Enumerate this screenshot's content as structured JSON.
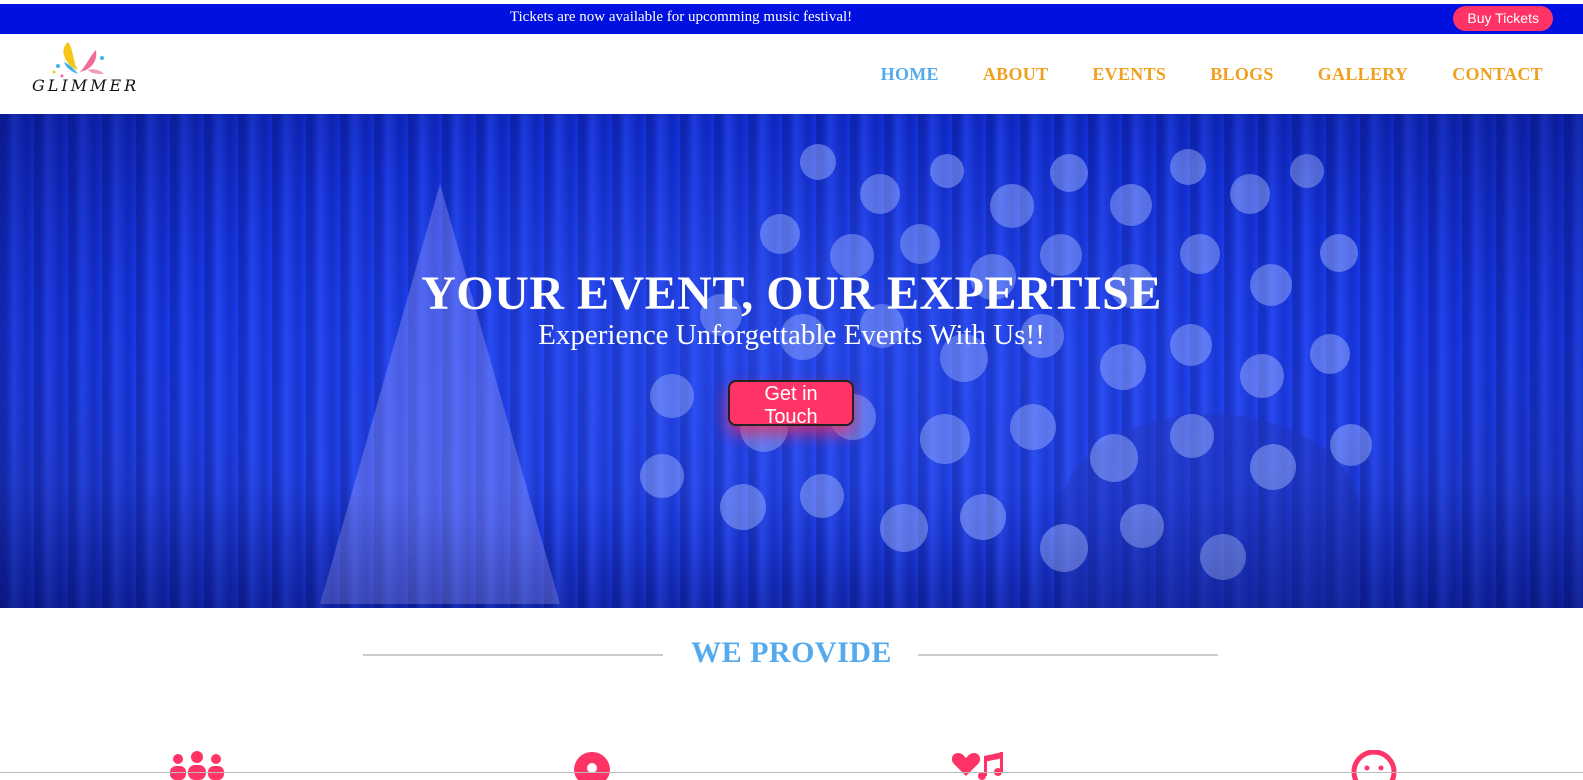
{
  "announcement": {
    "text": "Tickets are now available for upcomming music festival!",
    "button_label": "Buy Tickets"
  },
  "brand": {
    "logo_text": "GLIMMER"
  },
  "nav": {
    "items": [
      {
        "label": "HOME",
        "active": true
      },
      {
        "label": "ABOUT",
        "active": false
      },
      {
        "label": "EVENTS",
        "active": false
      },
      {
        "label": "BLOGS",
        "active": false
      },
      {
        "label": "GALLERY",
        "active": false
      },
      {
        "label": "CONTACT",
        "active": false
      }
    ]
  },
  "hero": {
    "title": "YOUR EVENT, OUR EXPERTISE",
    "subtitle": "Experience Unforgettable Events With Us!!",
    "cta_label": "Get in Touch"
  },
  "provide": {
    "title": "WE PROVIDE",
    "icons": [
      "people-group-icon",
      "map-pin-icon",
      "heart-music-icon",
      "smile-icon"
    ]
  },
  "colors": {
    "announce_bg": "#0010e0",
    "accent_pink": "#ff3366",
    "nav_orange": "#f0a020",
    "nav_active_blue": "#55aaee",
    "hero_blue": "#1a3cf0"
  }
}
